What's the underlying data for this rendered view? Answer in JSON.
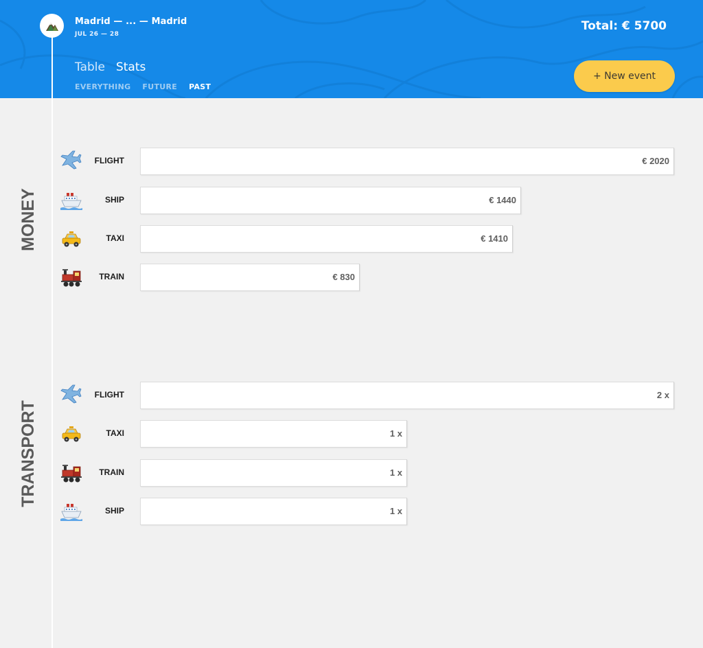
{
  "header": {
    "trip_title": "Madrid — ... — Madrid",
    "trip_dates": "JUL 26 — 28",
    "total": "Total: € 5700",
    "tabs": [
      {
        "label": "Table",
        "active": false
      },
      {
        "label": "Stats",
        "active": true
      }
    ],
    "filters": [
      {
        "label": "EVERYTHING",
        "active": false
      },
      {
        "label": "FUTURE",
        "active": false
      },
      {
        "label": "PAST",
        "active": true
      }
    ],
    "new_event_label": "+ New event",
    "colors": {
      "header_bg": "#1589e8",
      "button_bg": "#fbcb4c"
    }
  },
  "money": {
    "section_label": "MONEY",
    "max_value": 2020,
    "rows": [
      {
        "type": "FLIGHT",
        "icon": "airplane-icon",
        "value": 2020,
        "value_label": "€ 2020"
      },
      {
        "type": "SHIP",
        "icon": "ship-icon",
        "value": 1440,
        "value_label": "€ 1440"
      },
      {
        "type": "TAXI",
        "icon": "taxi-icon",
        "value": 1410,
        "value_label": "€ 1410"
      },
      {
        "type": "TRAIN",
        "icon": "locomotive-icon",
        "value": 830,
        "value_label": "€ 830"
      }
    ]
  },
  "transport": {
    "section_label": "TRANSPORT",
    "max_value": 2,
    "rows": [
      {
        "type": "FLIGHT",
        "icon": "airplane-icon",
        "value": 2,
        "value_label": "2 x"
      },
      {
        "type": "TAXI",
        "icon": "taxi-icon",
        "value": 1,
        "value_label": "1 x"
      },
      {
        "type": "TRAIN",
        "icon": "locomotive-icon",
        "value": 1,
        "value_label": "1 x"
      },
      {
        "type": "SHIP",
        "icon": "ship-icon",
        "value": 1,
        "value_label": "1 x"
      }
    ]
  }
}
